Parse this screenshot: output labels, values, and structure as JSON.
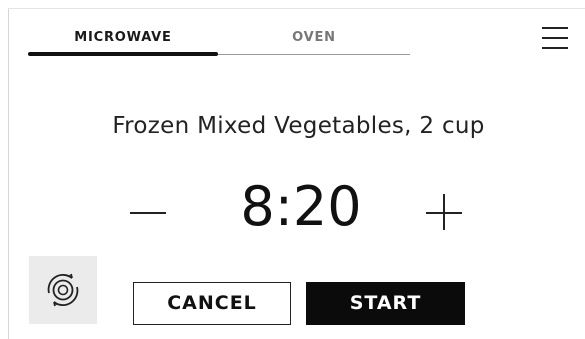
{
  "tabs": {
    "items": [
      {
        "label": "MICROWAVE",
        "active": true
      },
      {
        "label": "OVEN",
        "active": false
      }
    ]
  },
  "menu": {
    "icon": "hamburger-menu-icon"
  },
  "recipe": {
    "title": "Frozen Mixed Vegetables, 2 cup"
  },
  "timer": {
    "value": "8:20",
    "decrease_icon": "minus-icon",
    "increase_icon": "plus-icon"
  },
  "turntable": {
    "icon": "turntable-rotate-icon"
  },
  "actions": {
    "cancel_label": "CANCEL",
    "start_label": "START"
  },
  "colors": {
    "accent": "#0b0b0b",
    "background": "#ffffff",
    "inactive_text": "#777777",
    "turntable_bg": "#ebebeb"
  }
}
